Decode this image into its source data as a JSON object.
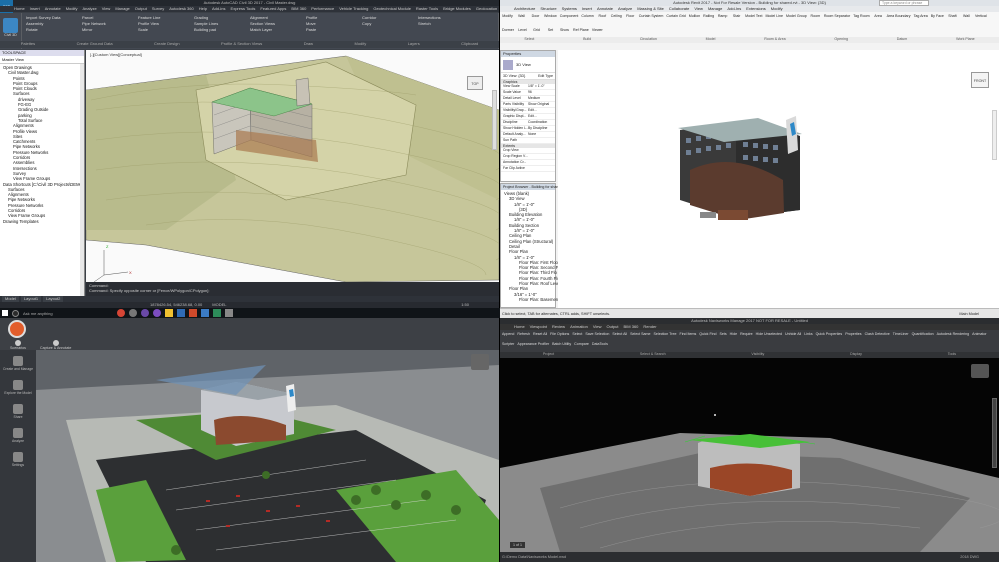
{
  "civil": {
    "title": "Autodesk AutoCAD Civil 3D 2017 - Civil Master.dwg",
    "app_badge": "Civil 3D",
    "tabs": [
      "Home",
      "Insert",
      "Annotate",
      "Modify",
      "Analyze",
      "View",
      "Manage",
      "Output",
      "Survey",
      "Autodesk 360",
      "Help",
      "Add-ins",
      "Express Tools",
      "Featured Apps",
      "BIM 360",
      "Performance",
      "Vehicle Tracking",
      "Geotechnical Module",
      "Raster Tools",
      "Bridge Modules",
      "Geolocation"
    ],
    "ribbon_buttons": [
      "Import Survey Data",
      "Parcel",
      "Feature Line",
      "Grading",
      "Alignment",
      "Profile",
      "Corridor",
      "Intersections",
      "Assembly",
      "Pipe Network",
      "Profile View",
      "Sample Lines",
      "Section Views",
      "Move",
      "Copy",
      "Stretch",
      "Rotate",
      "Mirror",
      "Scale",
      "Building pad",
      "Match Layer",
      "Paste"
    ],
    "ribbon_groups": [
      "Palettes",
      "Create Ground Data",
      "Create Design",
      "Profile & Section Views",
      "Draw",
      "Modify",
      "Layers",
      "Clipboard"
    ],
    "viewport_label": "[-][Custom View][Conceptual]",
    "viewcube_label": "TOP",
    "toolspace_title": "TOOLSPACE",
    "master_view": "Master View",
    "tree": [
      {
        "t": "Open Drawings",
        "d": 0
      },
      {
        "t": "Civil Master.dwg",
        "d": 1
      },
      {
        "t": "Points",
        "d": 2
      },
      {
        "t": "Point Groups",
        "d": 2
      },
      {
        "t": "Point Clouds",
        "d": 2
      },
      {
        "t": "Surfaces",
        "d": 2
      },
      {
        "t": "driveway",
        "d": 3
      },
      {
        "t": "FG-EG",
        "d": 3
      },
      {
        "t": "Grading Outside",
        "d": 3
      },
      {
        "t": "parking",
        "d": 3
      },
      {
        "t": "Total Surface",
        "d": 3
      },
      {
        "t": "Alignments",
        "d": 2
      },
      {
        "t": "Profile Views",
        "d": 2
      },
      {
        "t": "Sites",
        "d": 2
      },
      {
        "t": "Catchments",
        "d": 2
      },
      {
        "t": "Pipe Networks",
        "d": 2
      },
      {
        "t": "Pressure Networks",
        "d": 2
      },
      {
        "t": "Corridors",
        "d": 2
      },
      {
        "t": "Assemblies",
        "d": 2
      },
      {
        "t": "Intersections",
        "d": 2
      },
      {
        "t": "Survey",
        "d": 2
      },
      {
        "t": "View Frame Groups",
        "d": 2
      },
      {
        "t": "Data Shortcuts [C:\\Civil 3D Projects\\DEMO]",
        "d": 0
      },
      {
        "t": "Surfaces",
        "d": 1
      },
      {
        "t": "Alignments",
        "d": 1
      },
      {
        "t": "Pipe Networks",
        "d": 1
      },
      {
        "t": "Pressure Networks",
        "d": 1
      },
      {
        "t": "Corridors",
        "d": 1
      },
      {
        "t": "View Frame Groups",
        "d": 1
      },
      {
        "t": "Drawing Templates",
        "d": 0
      }
    ],
    "cmd_line1": "Command:",
    "cmd_line2": "Command: Specify opposite corner or [Fence/WPolygon/CPolygon]:",
    "layout_tabs": [
      "Model",
      "Layout1",
      "Layout2"
    ],
    "status_coords": "1878426.54, 546238.68, 0.00",
    "status_model": "MODEL",
    "status_scale": "1:50"
  },
  "taskbar": {
    "search_placeholder": "Ask me anything"
  },
  "revit": {
    "title": "Autodesk Revit 2017 - Not For Resale Version - Building for shared.rvt - 3D View: {3D}",
    "search_placeholder": "Type a keyword or phrase",
    "tabs": [
      "Architecture",
      "Structure",
      "Systems",
      "Insert",
      "Annotate",
      "Analyze",
      "Massing & Site",
      "Collaborate",
      "View",
      "Manage",
      "Add-Ins",
      "Extensions",
      "Modify"
    ],
    "buttons": [
      "Modify",
      "Wall",
      "Door",
      "Window",
      "Component",
      "Column",
      "Roof",
      "Ceiling",
      "Floor",
      "Curtain System",
      "Curtain Grid",
      "Mullion",
      "Railing",
      "Ramp",
      "Stair",
      "Model Text",
      "Model Line",
      "Model Group",
      "Room",
      "Room Separator",
      "Tag Room",
      "Area",
      "Area Boundary",
      "Tag Area",
      "By Face",
      "Shaft",
      "Wall",
      "Vertical",
      "Dormer",
      "Level",
      "Grid",
      "Set",
      "Show",
      "Ref Plane",
      "Viewer"
    ],
    "groups": [
      "Select",
      "Build",
      "Circulation",
      "Model",
      "Room & Area",
      "Opening",
      "Datum",
      "Work Plane"
    ],
    "properties_title": "Properties",
    "view_type": "3D View",
    "view_selector": "3D View: {3D}",
    "edit_type": "Edit Type",
    "graphics_header": "Graphics",
    "props": [
      [
        "View Scale",
        "1/8\" = 1'-0\""
      ],
      [
        "Scale Value",
        "96"
      ],
      [
        "Detail Level",
        "Medium"
      ],
      [
        "Parts Visibility",
        "Show Original"
      ],
      [
        "Visibility/Grap...",
        "Edit..."
      ],
      [
        "Graphic Displ...",
        "Edit..."
      ],
      [
        "Discipline",
        "Coordination"
      ],
      [
        "Show Hidden L...",
        "By Discipline"
      ],
      [
        "Default Analy...",
        "None"
      ],
      [
        "Sun Path",
        ""
      ]
    ],
    "extents_header": "Extents",
    "extents": [
      "Crop View",
      "Crop Region V...",
      "Annotation Cr...",
      "Far Clip Active"
    ],
    "help_link": "Properties help",
    "apply_button": "Apply",
    "browser_title": "Project Browser - Building for shared.rvt",
    "browser": [
      {
        "t": "Views (blank)",
        "d": 0
      },
      {
        "t": "3D View",
        "d": 1
      },
      {
        "t": "1/8\" = 1'-0\"",
        "d": 2
      },
      {
        "t": "{3D}",
        "d": 3
      },
      {
        "t": "Building Elevation",
        "d": 1
      },
      {
        "t": "1/8\" = 1'-0\"",
        "d": 2
      },
      {
        "t": "Building Section",
        "d": 1
      },
      {
        "t": "1/8\" = 1'-0\"",
        "d": 2
      },
      {
        "t": "Ceiling Plan",
        "d": 1
      },
      {
        "t": "Ceiling Plan (Structural)",
        "d": 1
      },
      {
        "t": "Detail",
        "d": 1
      },
      {
        "t": "Floor Plan",
        "d": 1
      },
      {
        "t": "1/8\" = 1'-0\"",
        "d": 2
      },
      {
        "t": "Floor Plan: First Floor",
        "d": 3
      },
      {
        "t": "Floor Plan: Second Flo",
        "d": 3
      },
      {
        "t": "Floor Plan: Third Flo",
        "d": 3
      },
      {
        "t": "Floor Plan: Fourth Flo",
        "d": 3
      },
      {
        "t": "Floor Plan: Roof Level",
        "d": 3
      },
      {
        "t": "Floor Plan",
        "d": 1
      },
      {
        "t": "3/16\" = 1'-0\"",
        "d": 2
      },
      {
        "t": "Floor Plan: Basement",
        "d": 3
      }
    ],
    "status_text": "Click to select, TAB for alternates, CTRL adds, SHIFT unselects.",
    "status_model": "Main Model",
    "viewcube": "FRONT"
  },
  "infraworks": {
    "tools": [
      {
        "icon": "scenario-icon",
        "label": "Scenarios"
      },
      {
        "icon": "ucs-icon",
        "label": "Capture & Annotate"
      }
    ],
    "side_items": [
      "Create and Manage",
      "Explore the Model",
      "Share",
      "Analyze",
      "Settings"
    ]
  },
  "navis": {
    "title": "Autodesk Navisworks Manage 2017 NOT FOR RESALE - Untitled",
    "tabs": [
      "Home",
      "Viewpoint",
      "Review",
      "Animation",
      "View",
      "Output",
      "BIM 360",
      "Render"
    ],
    "buttons": [
      "Append",
      "Refresh",
      "Reset All",
      "File Options",
      "Select",
      "Save Selection",
      "Select All",
      "Select Same",
      "Selection Tree",
      "Find Items",
      "Quick Find",
      "Sets",
      "Hide",
      "Require",
      "Hide Unselected",
      "Unhide All",
      "Links",
      "Quick Properties",
      "Properties",
      "Clash Detective",
      "TimeLiner",
      "Quantification",
      "Autodesk Rendering",
      "Animator",
      "Scripter",
      "Appearance Profiler",
      "Batch Utility",
      "Compare",
      "DataTools"
    ],
    "groups": [
      "Project",
      "Select & Search",
      "Visibility",
      "Display",
      "Tools"
    ],
    "status_text": "G:\\Demo Data\\Navisworks Model.nwd",
    "page_nav": "1 of 1",
    "status_fps": "2018 DWG"
  }
}
